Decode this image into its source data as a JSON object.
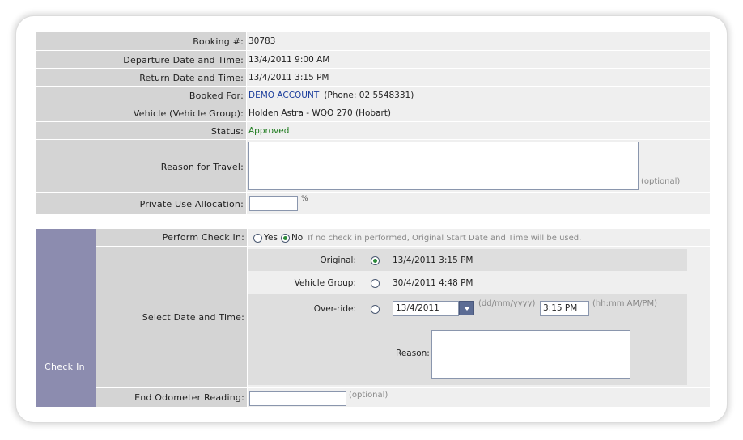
{
  "booking": {
    "booking_no_label": "Booking #:",
    "booking_no": "30783",
    "departure_label": "Departure Date and Time:",
    "departure": "13/4/2011 9:00 AM",
    "return_label": "Return Date and Time:",
    "return": "13/4/2011 3:15 PM",
    "booked_for_label": "Booked For:",
    "booked_for_name": "DEMO ACCOUNT",
    "booked_for_phone": "(Phone: 02 5548331)",
    "vehicle_label": "Vehicle (Vehicle Group):",
    "vehicle": "Holden Astra - WQO 270 (Hobart)",
    "status_label": "Status:",
    "status": "Approved",
    "reason_label": "Reason for Travel:",
    "reason_value": "",
    "reason_hint": "(optional)",
    "private_use_label": "Private Use Allocation:",
    "private_use_value": "",
    "private_use_unit": "%"
  },
  "checkin": {
    "section_label": "Check In",
    "perform_label": "Perform Check In:",
    "yes_label": "Yes",
    "no_label": "No",
    "perform_selected": "No",
    "perform_hint": "If no check in performed, Original Start Date and Time will be used.",
    "select_label": "Select Date and Time:",
    "original_label": "Original:",
    "original_value": "13/4/2011 3:15 PM",
    "vehicle_group_label": "Vehicle Group:",
    "vehicle_group_value": "30/4/2011 4:48 PM",
    "override_label": "Over-ride:",
    "override_date": "13/4/2011",
    "override_date_hint": "(dd/mm/yyyy)",
    "override_time": "3:15 PM",
    "override_time_hint": "(hh:mm AM/PM)",
    "override_reason_label": "Reason:",
    "override_reason_value": "",
    "selected_option": "Original",
    "odometer_label": "End Odometer Reading:",
    "odometer_value": "",
    "odometer_hint": "(optional)"
  },
  "colors": {
    "label_bg": "#d4d4d4",
    "value_bg": "#efefef",
    "section_bg": "#8c8caf",
    "link": "#1a3d9c",
    "status_ok": "#1d7a1d"
  }
}
